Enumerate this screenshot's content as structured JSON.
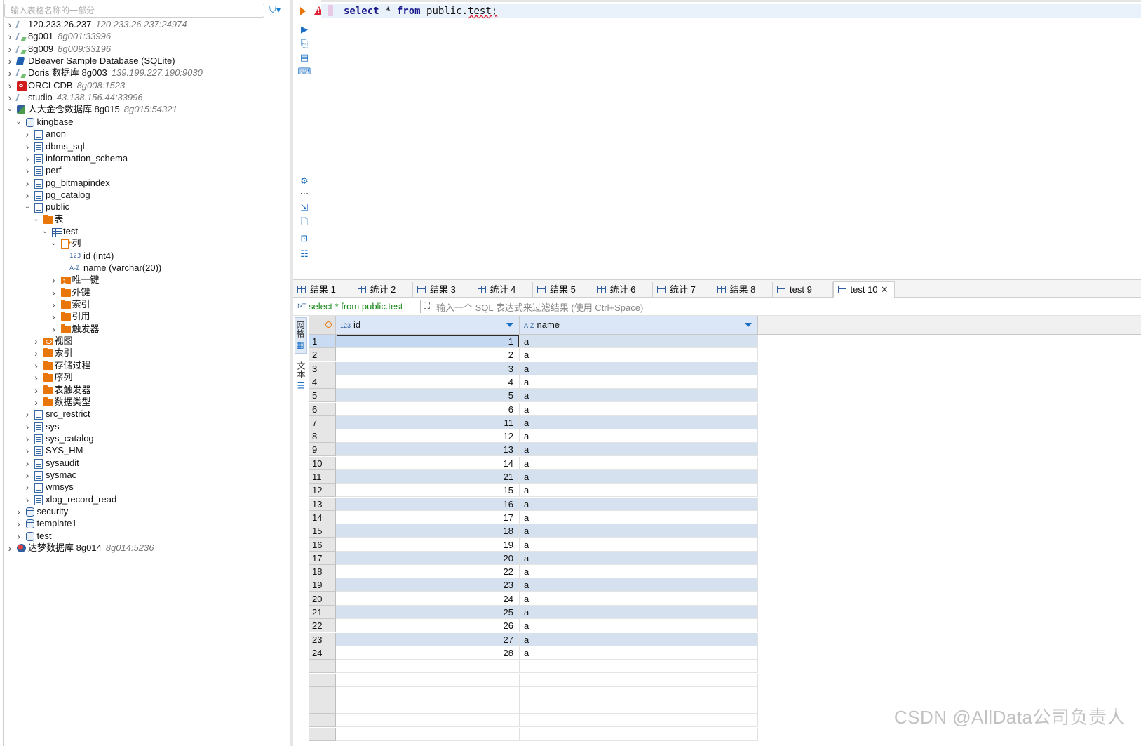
{
  "navigator": {
    "filter_placeholder": "输入表格名称的一部分",
    "tree": [
      {
        "level": 0,
        "expanded": false,
        "icon": "connection-icon",
        "label": "120.233.26.237",
        "sub": "120.233.26.237:24974"
      },
      {
        "level": 0,
        "expanded": false,
        "icon": "connection-ok-icon",
        "label": "8g001",
        "sub": "8g001:33996"
      },
      {
        "level": 0,
        "expanded": false,
        "icon": "connection-ok-icon",
        "label": "8g009",
        "sub": "8g009:33196"
      },
      {
        "level": 0,
        "expanded": false,
        "icon": "sqlite-icon",
        "label": "DBeaver Sample Database (SQLite)",
        "sub": ""
      },
      {
        "level": 0,
        "expanded": false,
        "icon": "connection-ok-icon",
        "label": "Doris 数据库 8g003",
        "sub": "139.199.227.190:9030"
      },
      {
        "level": 0,
        "expanded": false,
        "icon": "oracle-icon",
        "label": "ORCLCDB",
        "sub": "8g008:1523"
      },
      {
        "level": 0,
        "expanded": false,
        "icon": "connection-icon",
        "label": "studio",
        "sub": "43.138.156.44:33996"
      },
      {
        "level": 0,
        "expanded": true,
        "icon": "kingbase-icon",
        "label": "人大金仓数据库 8g015",
        "sub": "8g015:54321"
      },
      {
        "level": 1,
        "expanded": true,
        "icon": "database-icon",
        "label": "kingbase",
        "sub": ""
      },
      {
        "level": 2,
        "expanded": false,
        "icon": "schema-icon",
        "label": "anon",
        "sub": ""
      },
      {
        "level": 2,
        "expanded": false,
        "icon": "schema-icon",
        "label": "dbms_sql",
        "sub": ""
      },
      {
        "level": 2,
        "expanded": false,
        "icon": "schema-icon",
        "label": "information_schema",
        "sub": ""
      },
      {
        "level": 2,
        "expanded": false,
        "icon": "schema-icon",
        "label": "perf",
        "sub": ""
      },
      {
        "level": 2,
        "expanded": false,
        "icon": "schema-icon",
        "label": "pg_bitmapindex",
        "sub": ""
      },
      {
        "level": 2,
        "expanded": false,
        "icon": "schema-icon",
        "label": "pg_catalog",
        "sub": ""
      },
      {
        "level": 2,
        "expanded": true,
        "icon": "schema-icon",
        "label": "public",
        "sub": ""
      },
      {
        "level": 3,
        "expanded": true,
        "icon": "folder-icon",
        "label": "表",
        "sub": ""
      },
      {
        "level": 4,
        "expanded": true,
        "icon": "table-icon",
        "label": "test",
        "sub": ""
      },
      {
        "level": 5,
        "expanded": true,
        "icon": "columns-icon",
        "label": "列",
        "sub": ""
      },
      {
        "level": 6,
        "expanded": null,
        "icon": "numeric-column-icon",
        "label": "id (int4)",
        "sub": ""
      },
      {
        "level": 6,
        "expanded": null,
        "icon": "text-column-icon",
        "label": "name (varchar(20))",
        "sub": ""
      },
      {
        "level": 5,
        "expanded": false,
        "icon": "unique-key-icon",
        "label": "唯一键",
        "sub": ""
      },
      {
        "level": 5,
        "expanded": false,
        "icon": "folder-icon",
        "label": "外键",
        "sub": ""
      },
      {
        "level": 5,
        "expanded": false,
        "icon": "folder-icon",
        "label": "索引",
        "sub": ""
      },
      {
        "level": 5,
        "expanded": false,
        "icon": "folder-icon",
        "label": "引用",
        "sub": ""
      },
      {
        "level": 5,
        "expanded": false,
        "icon": "folder-icon",
        "label": "触发器",
        "sub": ""
      },
      {
        "level": 3,
        "expanded": false,
        "icon": "view-icon",
        "label": "视图",
        "sub": ""
      },
      {
        "level": 3,
        "expanded": false,
        "icon": "folder-icon",
        "label": "索引",
        "sub": ""
      },
      {
        "level": 3,
        "expanded": false,
        "icon": "folder-icon",
        "label": "存储过程",
        "sub": ""
      },
      {
        "level": 3,
        "expanded": false,
        "icon": "folder-icon",
        "label": "序列",
        "sub": ""
      },
      {
        "level": 3,
        "expanded": false,
        "icon": "folder-icon",
        "label": "表触发器",
        "sub": ""
      },
      {
        "level": 3,
        "expanded": false,
        "icon": "folder-icon",
        "label": "数据类型",
        "sub": ""
      },
      {
        "level": 2,
        "expanded": false,
        "icon": "schema-icon",
        "label": "src_restrict",
        "sub": ""
      },
      {
        "level": 2,
        "expanded": false,
        "icon": "schema-icon",
        "label": "sys",
        "sub": ""
      },
      {
        "level": 2,
        "expanded": false,
        "icon": "schema-icon",
        "label": "sys_catalog",
        "sub": ""
      },
      {
        "level": 2,
        "expanded": false,
        "icon": "schema-icon",
        "label": "SYS_HM",
        "sub": ""
      },
      {
        "level": 2,
        "expanded": false,
        "icon": "schema-icon",
        "label": "sysaudit",
        "sub": ""
      },
      {
        "level": 2,
        "expanded": false,
        "icon": "schema-icon",
        "label": "sysmac",
        "sub": ""
      },
      {
        "level": 2,
        "expanded": false,
        "icon": "schema-icon",
        "label": "wmsys",
        "sub": ""
      },
      {
        "level": 2,
        "expanded": false,
        "icon": "schema-icon",
        "label": "xlog_record_read",
        "sub": ""
      },
      {
        "level": 1,
        "expanded": false,
        "icon": "database-icon",
        "label": "security",
        "sub": ""
      },
      {
        "level": 1,
        "expanded": false,
        "icon": "database-icon",
        "label": "template1",
        "sub": ""
      },
      {
        "level": 1,
        "expanded": false,
        "icon": "database-icon",
        "label": "test",
        "sub": ""
      },
      {
        "level": 0,
        "expanded": false,
        "icon": "dameng-icon",
        "label": "达梦数据库 8g014",
        "sub": "8g014:5236"
      }
    ]
  },
  "editor": {
    "code_tokens": [
      {
        "t": "select",
        "k": true
      },
      {
        "t": " * ",
        "k": false
      },
      {
        "t": "from",
        "k": true
      },
      {
        "t": " public.",
        "k": false
      },
      {
        "t": "test;",
        "k": false,
        "err": true
      }
    ]
  },
  "results": {
    "tabs": [
      "结果 1",
      "统计 2",
      "结果 3",
      "统计 4",
      "结果 5",
      "统计 6",
      "统计 7",
      "结果 8",
      "test 9",
      "test 10"
    ],
    "active_tab": "test 10",
    "close_glyph": "✕",
    "query_label": "select * from public.test",
    "filter_placeholder": "输入一个 SQL 表达式来过滤结果 (使用 Ctrl+Space)",
    "side_tabs": {
      "grid": "网格",
      "text": "文本"
    },
    "columns": [
      {
        "type_badge": "123",
        "name": "id"
      },
      {
        "type_badge": "A-Z",
        "name": "name"
      }
    ],
    "rows": [
      [
        1,
        "a"
      ],
      [
        2,
        "a"
      ],
      [
        3,
        "a"
      ],
      [
        4,
        "a"
      ],
      [
        5,
        "a"
      ],
      [
        6,
        "a"
      ],
      [
        11,
        "a"
      ],
      [
        12,
        "a"
      ],
      [
        13,
        "a"
      ],
      [
        14,
        "a"
      ],
      [
        21,
        "a"
      ],
      [
        15,
        "a"
      ],
      [
        16,
        "a"
      ],
      [
        17,
        "a"
      ],
      [
        18,
        "a"
      ],
      [
        19,
        "a"
      ],
      [
        20,
        "a"
      ],
      [
        22,
        "a"
      ],
      [
        23,
        "a"
      ],
      [
        24,
        "a"
      ],
      [
        25,
        "a"
      ],
      [
        26,
        "a"
      ],
      [
        27,
        "a"
      ],
      [
        28,
        "a"
      ]
    ]
  },
  "watermark": "CSDN @AllData公司负责人"
}
